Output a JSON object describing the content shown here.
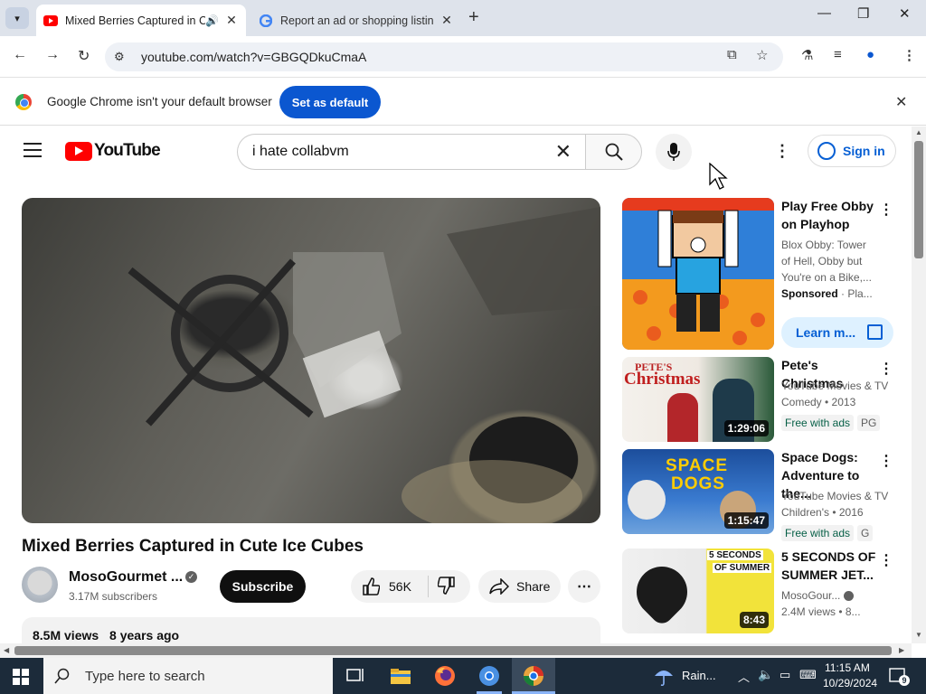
{
  "browser": {
    "tabs": [
      {
        "title": "Mixed Berries Captured in C",
        "active": true
      },
      {
        "title": "Report an ad or shopping listin",
        "active": false
      }
    ],
    "url": "youtube.com/watch?v=GBGQDkuCmaA"
  },
  "infobar": {
    "message": "Google Chrome isn't your default browser",
    "button_label": "Set as default"
  },
  "youtube": {
    "logo_text": "YouTube",
    "search_query": "i hate collabvm",
    "sign_in_label": "Sign in"
  },
  "video": {
    "title": "Mixed Berries Captured in Cute Ice Cubes",
    "channel_name": "MosoGourmet ...",
    "subscribers": "3.17M subscribers",
    "subscribe_label": "Subscribe",
    "likes": "56K",
    "share_label": "Share",
    "views": "8.5M views",
    "age": "8 years ago"
  },
  "sidebar": {
    "items": [
      {
        "title_line1": "Play Free Obby",
        "title_line2": "on Playhop",
        "meta_line1": "Blox Obby: Tower",
        "meta_line2": "of Hell, Obby but",
        "meta_line3": "You're on a Bike,...",
        "sponsored_label": "Sponsored",
        "sponsor_suffix": "· Pla...",
        "cta_label": "Learn m..."
      },
      {
        "title_line1": "Pete's Christmas",
        "meta_line1": "YouTube Movies & TV",
        "meta_line2": "Comedy • 2013",
        "badge_free": "Free with ads",
        "badge_rating": "PG",
        "duration": "1:29:06",
        "thumb_text_top": "PETE'S",
        "thumb_text_bottom": "Christmas"
      },
      {
        "title_line1": "Space Dogs:",
        "title_line2": "Adventure to the...",
        "meta_line1": "YouTube Movies & TV",
        "meta_line2": "Children's • 2016",
        "badge_free": "Free with ads",
        "badge_rating": "G",
        "duration": "1:15:47",
        "thumb_text_top": "SPACE",
        "thumb_text_bottom": "DOGS"
      },
      {
        "title_line1": "5 SECONDS OF",
        "title_line2": "SUMMER JET...",
        "meta_line1": "MosoGour...",
        "meta_line2": "2.4M views • 8...",
        "duration": "8:43",
        "thumb_text_top": "5 SECONDS",
        "thumb_text_bottom": "OF SUMMER"
      }
    ]
  },
  "taskbar": {
    "search_placeholder": "Type here to search",
    "weather": "Rain...",
    "time": "11:15 AM",
    "date": "10/29/2024",
    "notifications": "9"
  },
  "colors": {
    "brand_red": "#ff0000",
    "link_blue": "#065fd4",
    "chrome_blue": "#0b57d0"
  }
}
